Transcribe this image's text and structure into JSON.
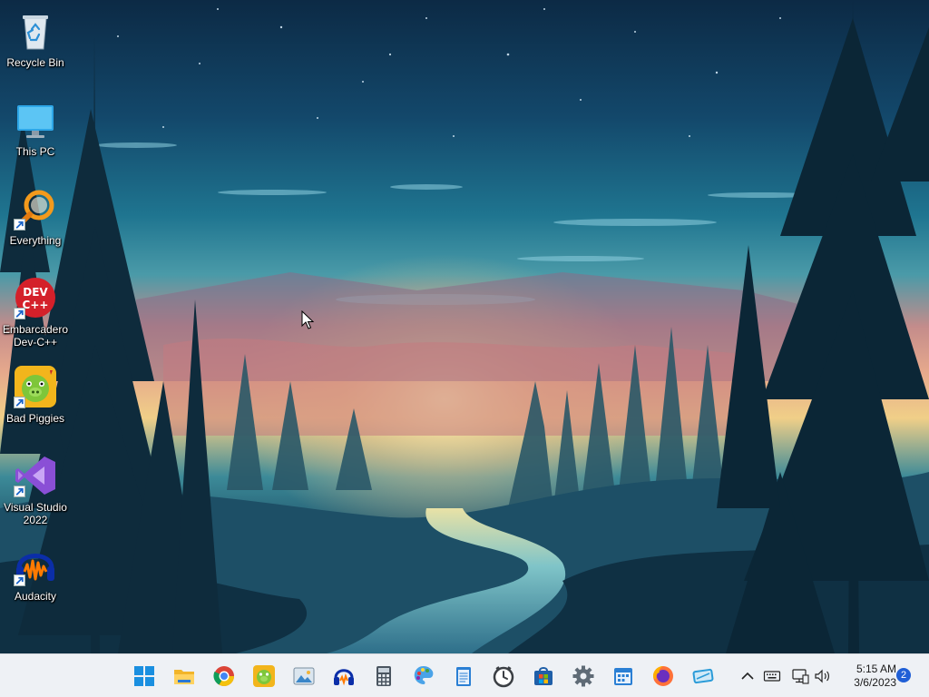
{
  "desktop": {
    "icons": [
      {
        "label": "Recycle Bin",
        "icon": "recycle-bin-icon"
      },
      {
        "label": "This PC",
        "icon": "monitor-icon"
      },
      {
        "label": "Everything",
        "icon": "search-magnifier-icon"
      },
      {
        "label": "Embarcadero Dev-C++",
        "icon": "devcpp-icon",
        "glyph_top": "DEV",
        "glyph_bottom": "C++"
      },
      {
        "label": "Bad Piggies",
        "icon": "bad-piggies-icon"
      },
      {
        "label": "Visual Studio 2022",
        "icon": "visual-studio-icon"
      },
      {
        "label": "Audacity",
        "icon": "audacity-icon"
      }
    ]
  },
  "taskbar": {
    "apps": [
      {
        "name": "start",
        "icon": "windows-logo-icon"
      },
      {
        "name": "file-explorer",
        "icon": "folder-icon"
      },
      {
        "name": "chrome",
        "icon": "chrome-icon"
      },
      {
        "name": "bad-piggies",
        "icon": "bad-piggies-icon"
      },
      {
        "name": "photos",
        "icon": "photos-icon"
      },
      {
        "name": "headphones-app",
        "icon": "headphones-icon"
      },
      {
        "name": "calculator",
        "icon": "calculator-icon"
      },
      {
        "name": "paint",
        "icon": "paint-palette-icon"
      },
      {
        "name": "notepad",
        "icon": "notepad-icon"
      },
      {
        "name": "clock",
        "icon": "clock-icon"
      },
      {
        "name": "store",
        "icon": "store-icon"
      },
      {
        "name": "settings",
        "icon": "gear-icon"
      },
      {
        "name": "calendar",
        "icon": "calendar-icon"
      },
      {
        "name": "firefox",
        "icon": "firefox-icon"
      },
      {
        "name": "snipping",
        "icon": "snipping-tool-icon"
      }
    ],
    "tray": {
      "icons": [
        "chevron-up-icon",
        "keyboard-icon",
        "network-icon",
        "speaker-icon"
      ],
      "time": "5:15 AM",
      "date": "3/6/2023",
      "notifications": "2"
    }
  },
  "colors": {
    "taskbar_bg": "#eef1f5",
    "badge": "#1f5fd6"
  }
}
